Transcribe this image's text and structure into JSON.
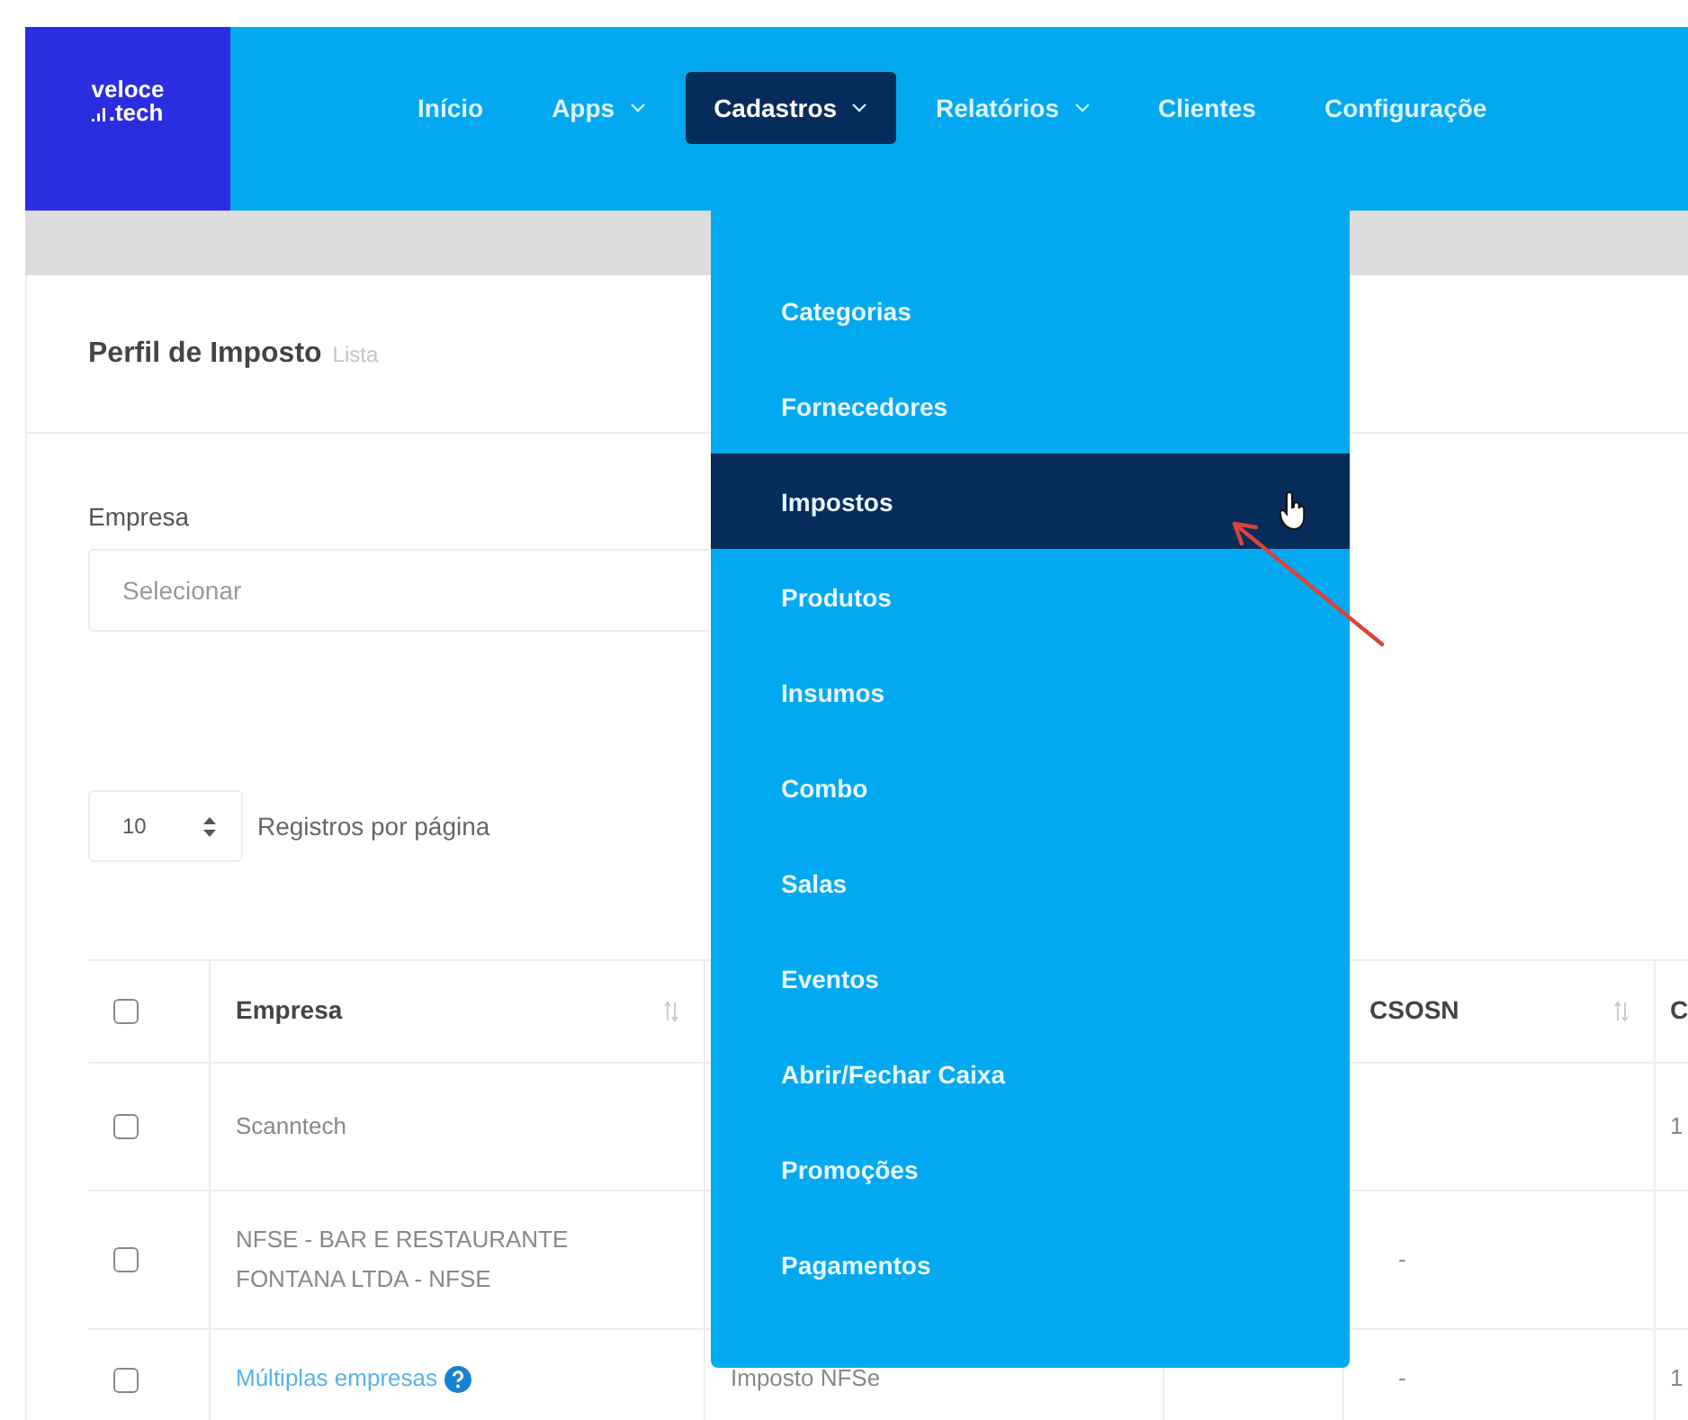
{
  "logo": {
    "line_1": "veloce",
    "line_2": ".tech"
  },
  "nav": [
    {
      "label": "Início",
      "dropdown": false,
      "selected": false
    },
    {
      "label": "Apps",
      "dropdown": true,
      "selected": false
    },
    {
      "label": "Cadastros",
      "dropdown": true,
      "selected": true
    },
    {
      "label": "Relatórios",
      "dropdown": true,
      "selected": false
    },
    {
      "label": "Clientes",
      "dropdown": false,
      "selected": false
    },
    {
      "label": "Configuraçõe",
      "dropdown": false,
      "selected": false
    }
  ],
  "menu": [
    {
      "label": "Categorias",
      "selected": false
    },
    {
      "label": "Fornecedores",
      "selected": false
    },
    {
      "label": "Impostos",
      "selected": true
    },
    {
      "label": "Produtos",
      "selected": false
    },
    {
      "label": "Insumos",
      "selected": false
    },
    {
      "label": "Combo",
      "selected": false
    },
    {
      "label": "Salas",
      "selected": false
    },
    {
      "label": "Eventos",
      "selected": false
    },
    {
      "label": "Abrir/Fechar Caixa",
      "selected": false
    },
    {
      "label": "Promoções",
      "selected": false
    },
    {
      "label": "Pagamentos",
      "selected": false
    }
  ],
  "page": {
    "title": "Perfil de Imposto",
    "subtitle": "Lista"
  },
  "filter": {
    "label": "Empresa",
    "placeholder": "Selecionar"
  },
  "page_size": {
    "value": "10",
    "label": "Registros por página"
  },
  "table": {
    "header_checked": false,
    "columns": [
      {
        "label": "Empresa",
        "sortable": true
      },
      {
        "label": "CSOSN",
        "sortable": true
      },
      {
        "label": "C"
      }
    ],
    "rows": [
      {
        "checked": false,
        "empresa": "Scanntech",
        "link": false,
        "help": false,
        "column_6": "1"
      },
      {
        "checked": false,
        "empresa": "NFSE - BAR E RESTAURANTE FONTANA LTDA - NFSE",
        "link": false,
        "help": false,
        "csosn": "-"
      },
      {
        "checked": false,
        "empresa": "Múltiplas empresas",
        "link": true,
        "help": true,
        "column_2": "Imposto NFSe",
        "csosn": "-",
        "column_6": "1"
      }
    ]
  }
}
